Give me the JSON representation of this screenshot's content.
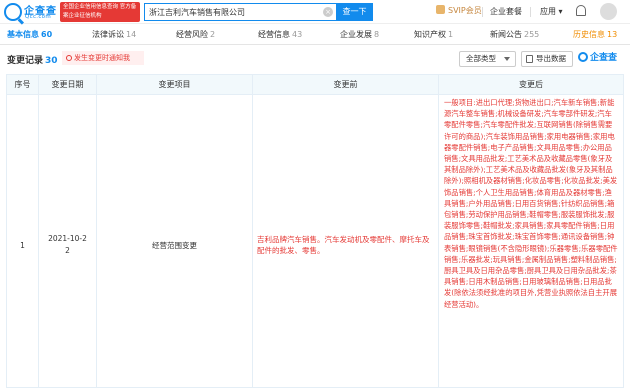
{
  "header": {
    "logo_text": "企查查",
    "logo_sub": "Qcc.com",
    "badge_text": "全国企业信用信息查询 官方备案企业征信机构",
    "search_value": "浙江吉利汽车销售有限公司",
    "search_clear": "×",
    "search_button": "查一下",
    "svip_label": "SVIP会员",
    "nav_package": "企业套餐",
    "nav_apps": "应用 ▾"
  },
  "tabs": [
    {
      "label": "基本信息",
      "count": "60"
    },
    {
      "label": "法律诉讼",
      "count": "14"
    },
    {
      "label": "经营风险",
      "count": "2"
    },
    {
      "label": "经营信息",
      "count": "43"
    },
    {
      "label": "企业发展",
      "count": "8"
    },
    {
      "label": "知识产权",
      "count": "1"
    },
    {
      "label": "新闻公告",
      "count": "255"
    },
    {
      "label": "历史信息",
      "count": "13"
    }
  ],
  "section": {
    "title": "变更记录",
    "count": "30",
    "notify": "发生变更时通知我",
    "filter": "全部类型",
    "export": "导出数据",
    "brand": "企查查"
  },
  "table": {
    "headers": [
      "序号",
      "变更日期",
      "变更项目",
      "变更前",
      "变更后"
    ],
    "rows": [
      {
        "index": "1",
        "date_line1": "2021-10-2",
        "date_line2": "2",
        "item": "经营范围变更",
        "before": "吉利品牌汽车销售。汽车发动机及零配件、摩托车及配件的批发、零售。",
        "after": "一般项目:进出口代理;货物进出口;汽车新车销售;新能源汽车整车销售;机械设备研发;汽车零部件研发;汽车零配件零售;汽车零配件批发;互联网销售(除销售需要许可的商品);汽车装饰用品销售;家用电器销售;家用电器零配件销售;电子产品销售;文具用品零售;办公用品销售;文具用品批发;工艺美术品及收藏品零售(象牙及其制品除外);工艺美术品及收藏品批发(象牙及其制品除外);照相机及器材销售;化妆品零售;化妆品批发;美发饰品销售;个人卫生用品销售;体育用品及器材零售;渔具销售;户外用品销售;日用百货销售;针纺织品销售;箱包销售;劳动保护用品销售;鞋帽零售;服装服饰批发;服装服饰零售;鞋帽批发;家具销售;家具零配件销售;日用品销售;珠宝首饰批发;珠宝首饰零售;通讯设备销售;钟表销售;眼镜销售(不含隐形眼镜);乐器零售;乐器零配件销售;乐器批发;玩具销售;金属制品销售;塑料制品销售;厨具卫具及日用杂品零售;厨具卫具及日用杂品批发;茶具销售;日用木制品销售;日用玻璃制品销售;日用品批发(除依法须经批准的项目外,凭营业执照依法自主开展经营活动)。"
      }
    ]
  },
  "colors": {
    "brand_blue": "#128bed",
    "accent_red": "#e53935",
    "header_bg": "#f2f9fc",
    "history_orange": "#f08c00"
  }
}
